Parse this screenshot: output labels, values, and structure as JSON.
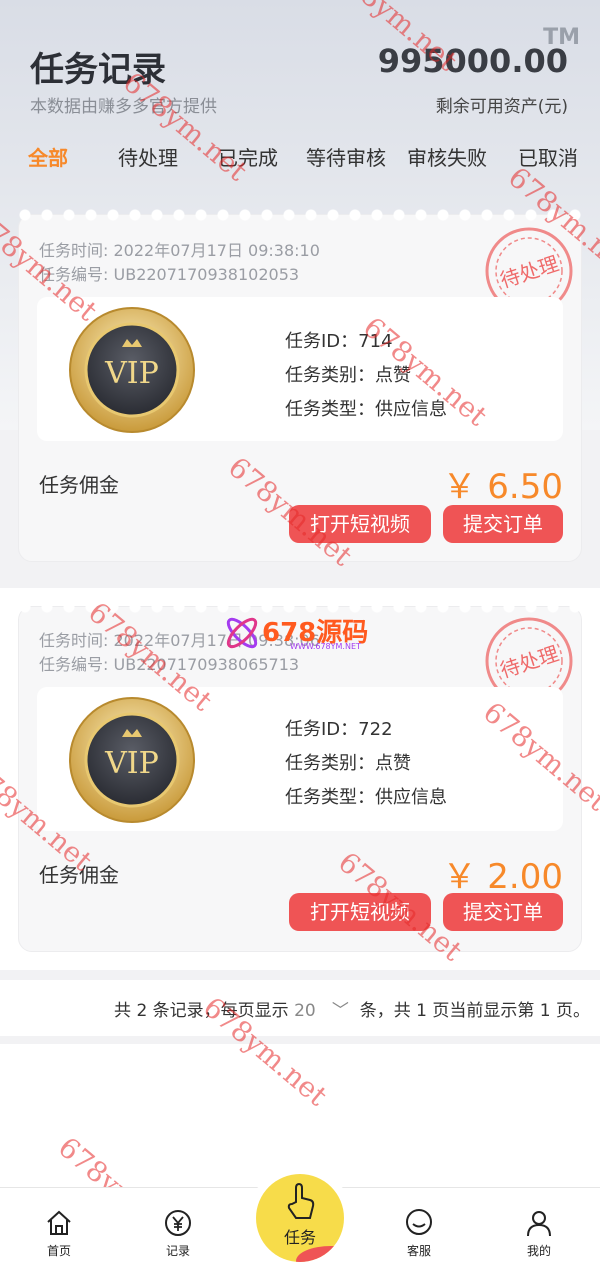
{
  "header": {
    "title": "任务记录",
    "subtitle": "本数据由赚多多官方提供",
    "balance": "995000.00",
    "balance_label": "剩余可用资产(元)",
    "tm": "TM"
  },
  "tabs": [
    "全部",
    "待处理",
    "已完成",
    "等待审核",
    "审核失败",
    "已取消"
  ],
  "active_tab": "全部",
  "tasks": [
    {
      "time_label": "任务时间:",
      "time": "2022年07月17日 09:38:10",
      "no_label": "任务编号:",
      "no": "UB2207170938102053",
      "id_text": "任务ID：714",
      "category_text": "任务类别：点赞",
      "type_text": "任务类型：供应信息",
      "commission_label": "任务佣金",
      "amount": "￥ 6.50",
      "btn_video": "打开短视频",
      "btn_submit": "提交订单",
      "status": "待处理",
      "badge": "VIP"
    },
    {
      "time_label": "任务时间:",
      "time": "2022年07月17日 09:38:06",
      "no_label": "任务编号:",
      "no": "UB2207170938065713",
      "id_text": "任务ID：722",
      "category_text": "任务类别：点赞",
      "type_text": "任务类型：供应信息",
      "commission_label": "任务佣金",
      "amount": "￥ 2.00",
      "btn_video": "打开短视频",
      "btn_submit": "提交订单",
      "status": "待处理",
      "badge": "VIP"
    }
  ],
  "pager": {
    "prefix": "共 2 条记录，每页显示",
    "page_size": "20",
    "suffix": "条，共 1 页当前显示第 1 页。"
  },
  "watermark_text": "678ym.net",
  "logo_watermark": {
    "brand": "678源码",
    "url": "WWW.678YM.NET"
  },
  "nav": {
    "home": "首页",
    "records": "记录",
    "task": "任务",
    "service": "客服",
    "mine": "我的"
  },
  "colors": {
    "accent": "#f7892a",
    "button": "#ef5455",
    "fab": "#f7dc4a"
  }
}
